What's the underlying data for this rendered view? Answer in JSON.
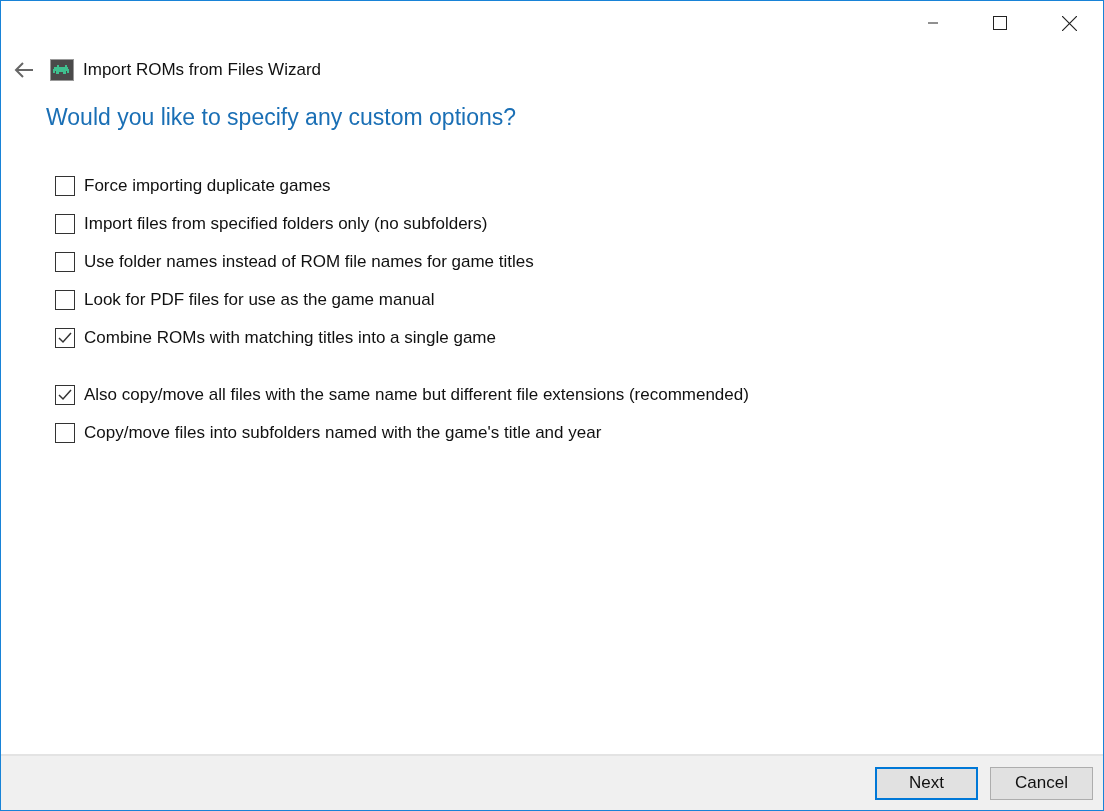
{
  "window": {
    "title": "Import ROMs from Files Wizard"
  },
  "heading": "Would you like to specify any custom options?",
  "option_groups": [
    {
      "options": [
        {
          "label": "Force importing duplicate games",
          "checked": false
        },
        {
          "label": "Import files from specified folders only (no subfolders)",
          "checked": false
        },
        {
          "label": "Use folder names instead of ROM file names for game titles",
          "checked": false
        },
        {
          "label": "Look for PDF files for use as the game manual",
          "checked": false
        },
        {
          "label": "Combine ROMs with matching titles into a single game",
          "checked": true
        }
      ]
    },
    {
      "options": [
        {
          "label": "Also copy/move all files with the same name but different file extensions (recommended)",
          "checked": true
        },
        {
          "label": "Copy/move files into subfolders named with the game's title and year",
          "checked": false
        }
      ]
    }
  ],
  "buttons": [
    {
      "label": "Next",
      "default": true
    },
    {
      "label": "Cancel",
      "default": false
    }
  ]
}
